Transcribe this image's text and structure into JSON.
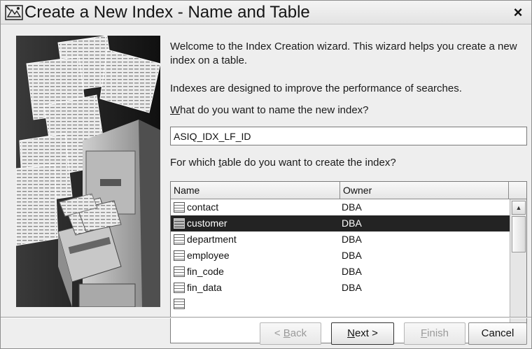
{
  "window": {
    "title": "Create a New Index - Name and Table",
    "close_glyph": "×"
  },
  "intro": {
    "welcome": "Welcome to the Index Creation wizard. This wizard helps you create a new index on a table.",
    "indexes": "Indexes are designed to improve the performance of searches."
  },
  "name_prompt": {
    "mnemonic": "W",
    "rest": "hat do you want to name the new index?"
  },
  "index_name": {
    "value": "ASIQ_IDX_LF_ID"
  },
  "table_prompt": {
    "before": "For which ",
    "mnemonic": "t",
    "after": "able do you want to create the index?"
  },
  "table": {
    "columns": [
      "Name",
      "Owner"
    ],
    "rows": [
      {
        "name": "contact",
        "owner": "DBA",
        "icon": "table-icon"
      },
      {
        "name": "customer",
        "owner": "DBA",
        "icon": "table-icon",
        "selected": true
      },
      {
        "name": "department",
        "owner": "DBA",
        "icon": "table-icon"
      },
      {
        "name": "employee",
        "owner": "DBA",
        "icon": "table-icon"
      },
      {
        "name": "fin_code",
        "owner": "DBA",
        "icon": "table-icon"
      },
      {
        "name": "fin_data",
        "owner": "DBA",
        "icon": "table-icon"
      }
    ],
    "scroll_up_glyph": "▲",
    "scroll_down_glyph": "▼"
  },
  "buttons": {
    "back": {
      "prefix": "< ",
      "mnemonic": "B",
      "rest": "ack",
      "enabled": false
    },
    "next": {
      "mnemonic": "N",
      "rest": "ext >",
      "enabled": true
    },
    "finish": {
      "mnemonic": "F",
      "rest": "inish",
      "enabled": false
    },
    "cancel": {
      "label": "Cancel",
      "enabled": true
    }
  },
  "colors": {
    "selection": "#232323",
    "window_bg": "#eeeeee"
  }
}
